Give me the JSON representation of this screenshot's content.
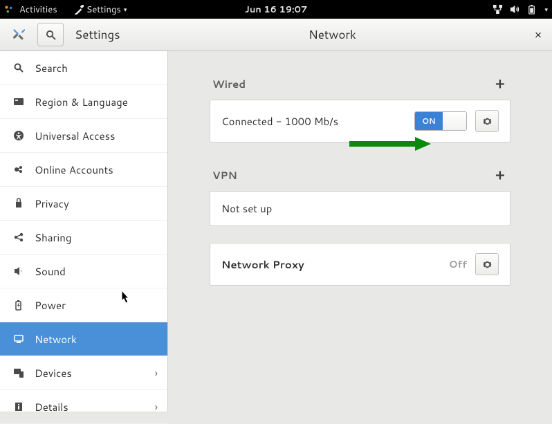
{
  "topbar": {
    "activities": "Activities",
    "app_menu": "Settings",
    "datetime": "Jun 16  19:07"
  },
  "window": {
    "settings_title": "Settings",
    "panel_title": "Network"
  },
  "sidebar": {
    "items": [
      {
        "label": "Search"
      },
      {
        "label": "Region & Language"
      },
      {
        "label": "Universal Access"
      },
      {
        "label": "Online Accounts"
      },
      {
        "label": "Privacy"
      },
      {
        "label": "Sharing"
      },
      {
        "label": "Sound"
      },
      {
        "label": "Power"
      },
      {
        "label": "Network"
      },
      {
        "label": "Devices"
      },
      {
        "label": "Details"
      }
    ]
  },
  "network": {
    "wired": {
      "heading": "Wired",
      "status": "Connected - 1000 Mb/s",
      "toggle_on_label": "ON"
    },
    "vpn": {
      "heading": "VPN",
      "status": "Not set up"
    },
    "proxy": {
      "heading": "Network Proxy",
      "state": "Off"
    }
  }
}
